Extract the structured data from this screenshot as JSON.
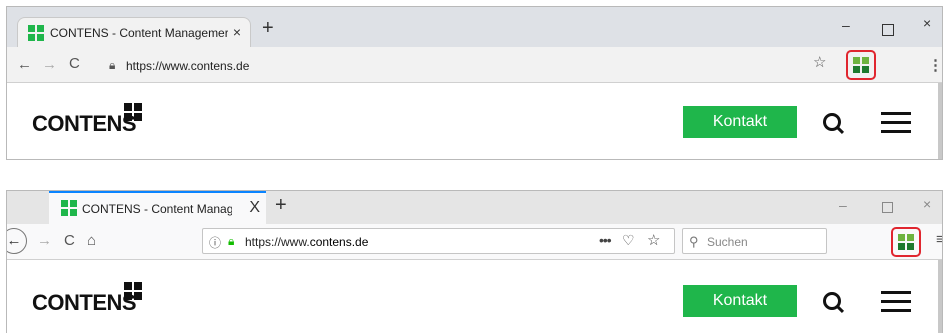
{
  "brand_colors": {
    "green": "#1fb64b",
    "highlight_red": "#e0262f",
    "firefox_blue": "#0a84ff"
  },
  "chrome": {
    "tab": {
      "title": "CONTENS - Content Managemer",
      "close": "×",
      "icon": "contens-favicon-icon"
    },
    "new_tab": "+",
    "window_controls": {
      "minimize": "–",
      "maximize": "",
      "close": "×"
    },
    "toolbar": {
      "back": "←",
      "forward": "→",
      "reload": "C",
      "url": "https://www.contens.de",
      "star": "☆",
      "menu": "⋮",
      "extension_icon": "contens-extension-icon"
    }
  },
  "firefox": {
    "tab": {
      "title": "CONTENS - Content Managem",
      "close": "X",
      "icon": "contens-favicon-icon"
    },
    "new_tab": "+",
    "window_controls": {
      "minimize": "–",
      "maximize": "",
      "close": "×"
    },
    "toolbar": {
      "back": "←",
      "forward": "→",
      "reload": "C",
      "home": "⌂",
      "info": "ⓘ",
      "url_prefix": "https://www.",
      "url_domain": "contens.de",
      "page_actions": "•••",
      "pocket": "♡",
      "star": "☆",
      "search_placeholder": "Suchen",
      "menu": "≡",
      "extension_icon": "contens-extension-icon"
    }
  },
  "website": {
    "logo_text": "CONTENS",
    "contact_button": "Kontakt",
    "search_icon": "search-icon",
    "menu_icon": "hamburger-icon"
  }
}
